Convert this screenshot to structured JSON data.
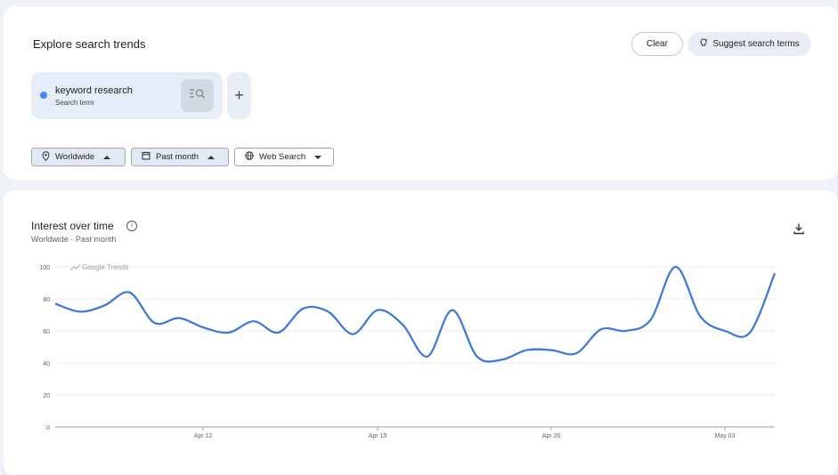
{
  "explore": {
    "title": "Explore search trends",
    "clear_label": "Clear",
    "suggest_label": "Suggest search terms",
    "term": {
      "name": "keyword research",
      "type": "Search term",
      "color": "#4285f4"
    },
    "add_label": "+",
    "filters": {
      "location": "Worldwide",
      "time": "Past month",
      "property": "Web Search"
    }
  },
  "interest": {
    "title": "Interest over time",
    "info": "i",
    "location": "Worldwide",
    "separator": "·",
    "time": "Past month",
    "watermark": "Google Trends"
  },
  "chart_data": {
    "type": "line",
    "x_tick_labels": [
      "Apr 12",
      "Apr 19",
      "Apr 26",
      "May 03"
    ],
    "y_ticks": [
      0,
      20,
      40,
      60,
      80,
      100
    ],
    "ylim": [
      0,
      100
    ],
    "grid": true,
    "series": [
      {
        "color": "#3a76dd",
        "values": [
          77,
          72,
          76,
          84,
          65,
          68,
          62,
          59,
          66,
          59,
          74,
          72,
          58,
          73,
          64,
          44,
          73,
          44,
          42,
          48,
          48,
          46,
          61,
          60,
          67,
          100,
          69,
          60,
          59,
          96
        ]
      }
    ]
  }
}
